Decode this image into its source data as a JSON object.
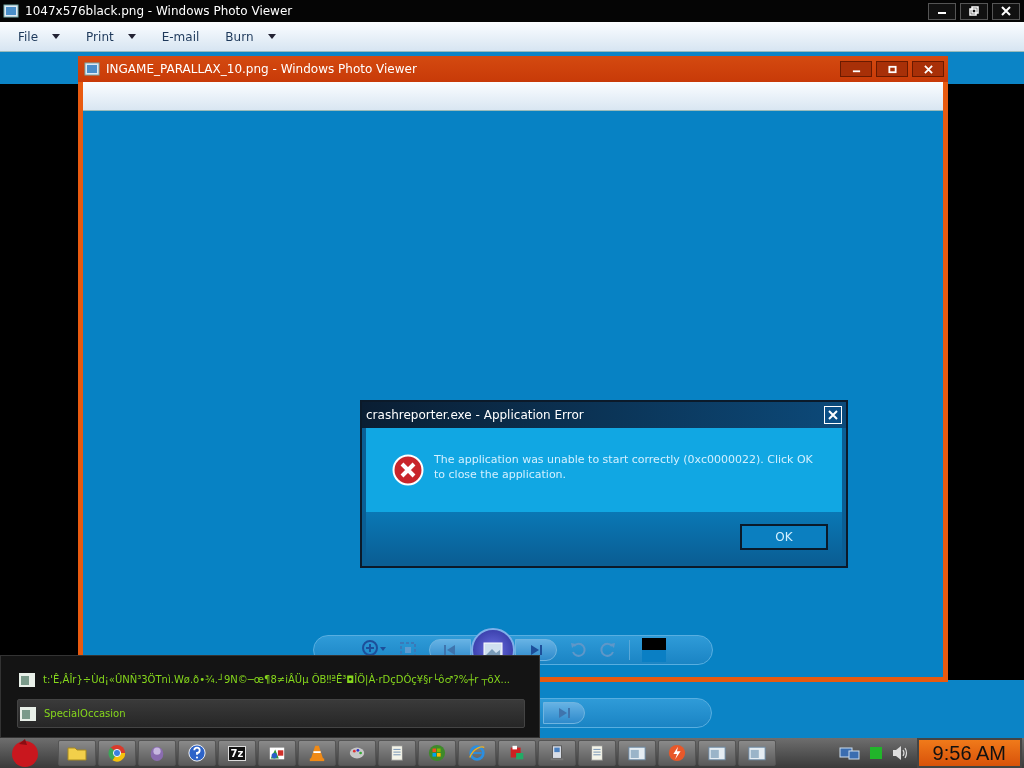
{
  "outer_window": {
    "title": "1047x576black.png - Windows Photo Viewer"
  },
  "menu": [
    {
      "label": "File",
      "dropdown": true
    },
    {
      "label": "Print",
      "dropdown": true
    },
    {
      "label": "E-mail",
      "dropdown": false
    },
    {
      "label": "Burn",
      "dropdown": true
    }
  ],
  "inner_window": {
    "title": "INGAME_PARALLAX_10.png - Windows Photo Viewer"
  },
  "dialog": {
    "title": "crashreporter.exe - Application Error",
    "message": "The application was unable to start correctly (0xc0000022). Click OK to close the application.",
    "button": "OK"
  },
  "thumbnail_list": [
    {
      "label": "t:'Ê,ÂÎr}÷Ùd¡«ÛNÑ³3ÖTnì.Wø.ð•¾.┘9N©─œ¶8≠iÂÜµ ÕB‼ªÊ³◘ÎÖ|À·rDçDÓç¥§r└ô♂?%┼r ┬õX...",
      "selected": false
    },
    {
      "label": "SpecialOccasion",
      "selected": true
    }
  ],
  "taskbar": {
    "items": [
      {
        "kind": "folder"
      },
      {
        "kind": "globe"
      },
      {
        "kind": "creature"
      },
      {
        "kind": "help"
      },
      {
        "kind": "archive",
        "label": "7z"
      },
      {
        "kind": "paint"
      },
      {
        "kind": "cone"
      },
      {
        "kind": "palette"
      },
      {
        "kind": "notepad"
      },
      {
        "kind": "flag"
      },
      {
        "kind": "browser"
      },
      {
        "kind": "app"
      },
      {
        "kind": "device"
      },
      {
        "kind": "notepad"
      },
      {
        "kind": "window"
      },
      {
        "kind": "power"
      },
      {
        "kind": "window"
      },
      {
        "kind": "window"
      }
    ],
    "clock": "9:56 AM"
  }
}
